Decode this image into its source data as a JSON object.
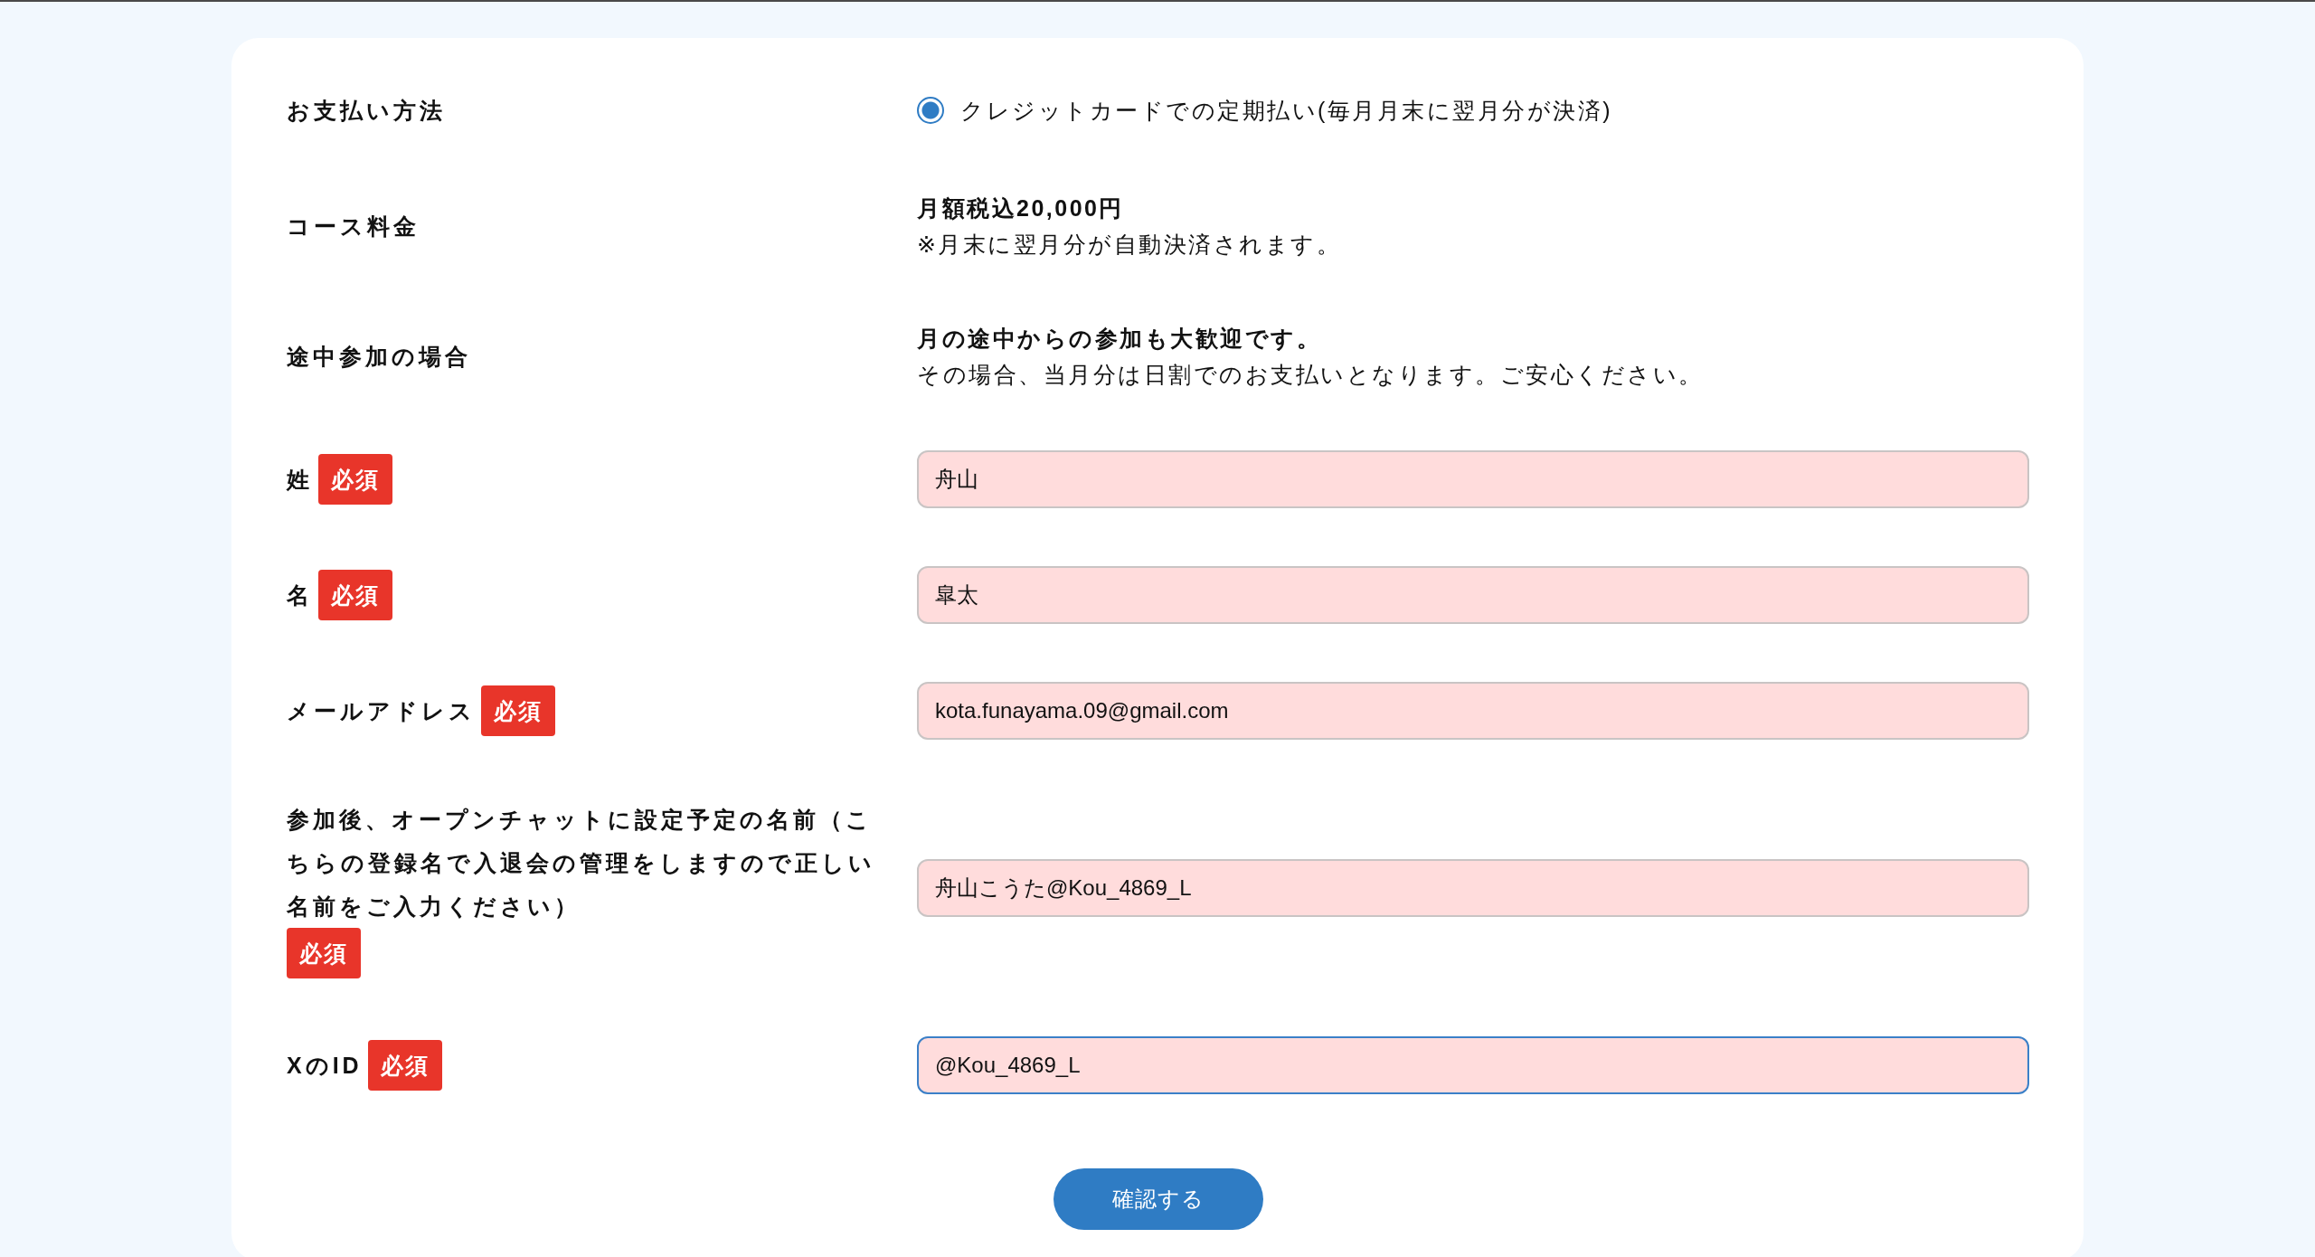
{
  "form": {
    "rows": [
      {
        "kind": "radio",
        "label": "お支払い方法",
        "options": [
          {
            "label": "クレジットカードでの定期払い(毎月月末に翌月分が決済)",
            "selected": true
          }
        ]
      },
      {
        "kind": "info",
        "label": "コース料金",
        "lines": [
          {
            "text": "月額税込20,000円",
            "bold": true
          },
          {
            "text": "※月末に翌月分が自動決済されます。",
            "bold": false
          }
        ]
      },
      {
        "kind": "info",
        "label": "途中参加の場合",
        "lines": [
          {
            "text": "月の途中からの参加も大歓迎です。",
            "bold": true
          },
          {
            "text": "その場合、当月分は日割でのお支払いとなります。ご安心ください。",
            "bold": false
          }
        ]
      },
      {
        "kind": "input",
        "label": "姓",
        "badge": "必須",
        "value": "舟山",
        "focused": false
      },
      {
        "kind": "input",
        "label": "名",
        "badge": "必須",
        "value": "皐太",
        "focused": false
      },
      {
        "kind": "input",
        "label": "メールアドレス",
        "badge": "必須",
        "value": "kota.funayama.09@gmail.com",
        "focused": false
      },
      {
        "kind": "input",
        "label": "参加後、オープンチャットに設定予定の名前（こちらの登録名で入退会の管理をしますので正しい名前をご入力ください）",
        "badge": "必須",
        "value": "舟山こうた@Kou_4869_L",
        "focused": false
      },
      {
        "kind": "input",
        "label": "XのID",
        "badge": "必須",
        "value": "@Kou_4869_L",
        "focused": true
      }
    ]
  },
  "submit_button": "確認する"
}
